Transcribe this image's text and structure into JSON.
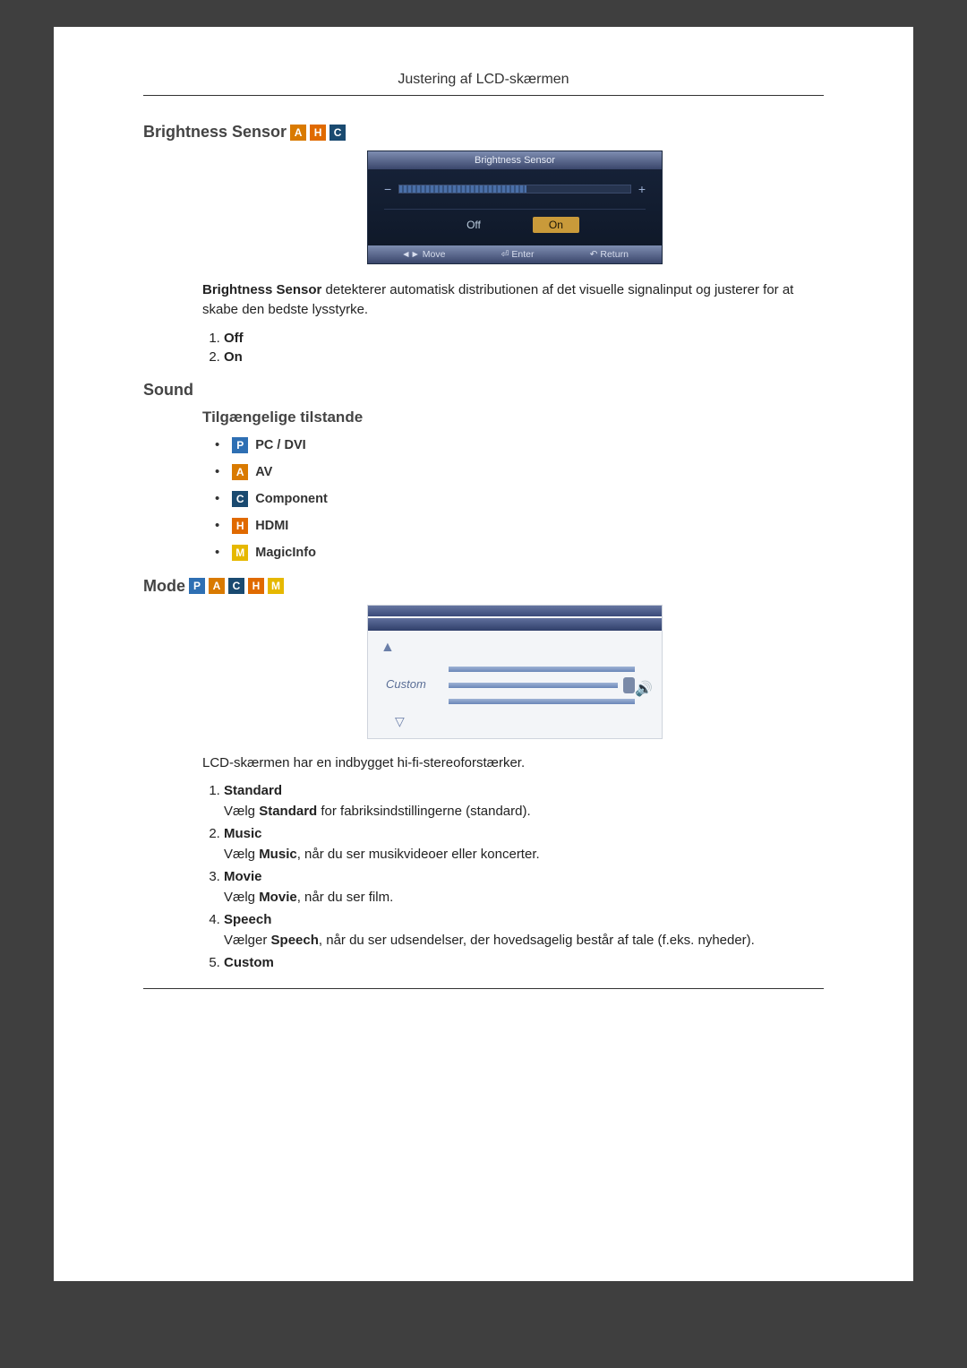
{
  "header": {
    "title": "Justering af LCD-skærmen"
  },
  "brightness_sensor": {
    "title": "Brightness Sensor",
    "badges": [
      "A",
      "H",
      "C"
    ],
    "osd": {
      "panel_title": "Brightness Sensor",
      "minus": "−",
      "plus": "+",
      "off_label": "Off",
      "on_label": "On",
      "foot_move": "◄► Move",
      "foot_enter": "⏎ Enter",
      "foot_return": "↶ Return"
    },
    "description_prefix": "Brightness Sensor",
    "description_rest": " detekterer automatisk distributionen af det visuelle signalinput og justerer for at skabe den bedste lysstyrke.",
    "options": [
      {
        "label": "Off"
      },
      {
        "label": "On"
      }
    ]
  },
  "sound": {
    "title": "Sound",
    "subtitle": "Tilgængelige tilstande",
    "modes": [
      {
        "badge": "P",
        "cls": "badge-p",
        "label": "PC / DVI"
      },
      {
        "badge": "A",
        "cls": "badge-a",
        "label": "AV"
      },
      {
        "badge": "C",
        "cls": "badge-c",
        "label": "Component"
      },
      {
        "badge": "H",
        "cls": "badge-h",
        "label": "HDMI"
      },
      {
        "badge": "M",
        "cls": "badge-m",
        "label": "MagicInfo"
      }
    ]
  },
  "mode": {
    "title": "Mode",
    "badges": [
      {
        "t": "P",
        "cls": "badge-p"
      },
      {
        "t": "A",
        "cls": "badge-a"
      },
      {
        "t": "C",
        "cls": "badge-c"
      },
      {
        "t": "H",
        "cls": "badge-h"
      },
      {
        "t": "M",
        "cls": "badge-m"
      }
    ],
    "figure": {
      "up": "▲",
      "down": "▽",
      "label": "Custom",
      "speaker": "🔊"
    },
    "intro": "LCD-skærmen har en indbygget hi-fi-stereoforstærker.",
    "items": [
      {
        "head": "Standard",
        "desc_pre": "Vælg ",
        "desc_bold": "Standard",
        "desc_post": " for fabriksindstillingerne (standard)."
      },
      {
        "head": "Music",
        "desc_pre": "Vælg ",
        "desc_bold": "Music",
        "desc_post": ", når du ser musikvideoer eller koncerter."
      },
      {
        "head": "Movie",
        "desc_pre": "Vælg ",
        "desc_bold": "Movie",
        "desc_post": ", når du ser film."
      },
      {
        "head": "Speech",
        "desc_pre": "Vælger ",
        "desc_bold": "Speech",
        "desc_post": ", når du ser udsendelser, der hovedsagelig består af tale (f.eks. nyheder)."
      },
      {
        "head": "Custom",
        "desc_pre": "",
        "desc_bold": "",
        "desc_post": ""
      }
    ]
  }
}
